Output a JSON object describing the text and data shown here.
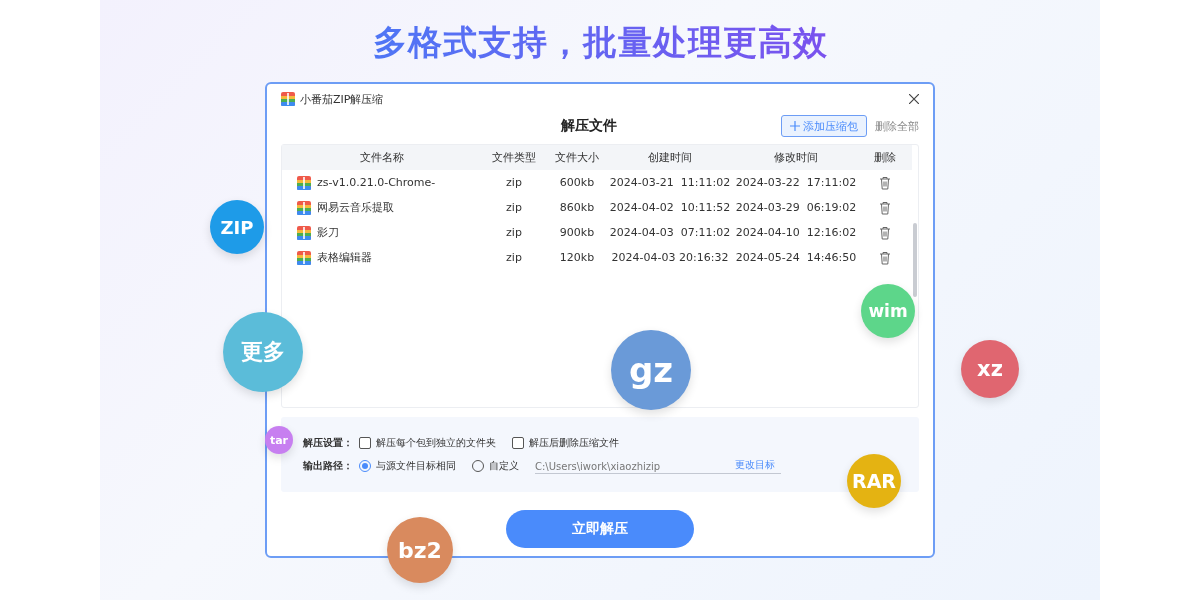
{
  "headline": "多格式支持，批量处理更高效",
  "window": {
    "title": "小番茄ZIP解压缩",
    "heading": "解压文件"
  },
  "toolbar": {
    "add_button": "添加压缩包",
    "delete_all": "删除全部"
  },
  "table": {
    "columns": [
      "文件名称",
      "文件类型",
      "文件大小",
      "创建时间",
      "修改时间",
      "删除"
    ],
    "rows": [
      {
        "name": "zs-v1.0.21.0-Chrome-",
        "type": "zip",
        "size": "600kb",
        "created": "2024-03-21  11:11:02",
        "modified": "2024-03-22  17:11:02"
      },
      {
        "name": "网易云音乐提取",
        "type": "zip",
        "size": "860kb",
        "created": "2024-04-02  10:11:52",
        "modified": "2024-03-29  06:19:02"
      },
      {
        "name": "影刀",
        "type": "zip",
        "size": "900kb",
        "created": "2024-04-03  07:11:02",
        "modified": "2024-04-10  12:16:02"
      },
      {
        "name": "表格编辑器",
        "type": "zip",
        "size": "120kb",
        "created": "2024-04-03 20:16:32",
        "modified": "2024-05-24  14:46:50"
      }
    ]
  },
  "settings": {
    "options_label": "解压设置：",
    "options": [
      {
        "label": "解压每个包到独立的文件夹",
        "checked": false
      },
      {
        "label": "解压后删除压缩文件",
        "checked": false
      }
    ],
    "output_label": "输出路径：",
    "destinations": [
      {
        "label": "与源文件目标相同",
        "selected": true
      },
      {
        "label": "自定义",
        "selected": false
      }
    ],
    "path": "C:\\Users\\iwork\\xiaozhizip",
    "change_link": "更改目标"
  },
  "primary_button": "立即解压",
  "badges": [
    {
      "label": "ZIP",
      "color": "#1e9be8"
    },
    {
      "label": "更多",
      "color": "#5bbcd9"
    },
    {
      "label": "tar",
      "color": "#c77ff0"
    },
    {
      "label": "bz2",
      "color": "#d98a5e"
    },
    {
      "label": "gz",
      "color": "#6a9ad8"
    },
    {
      "label": "wim",
      "color": "#5dd68a"
    },
    {
      "label": "xz",
      "color": "#e06670"
    },
    {
      "label": "RAR",
      "color": "#e4b312"
    }
  ]
}
